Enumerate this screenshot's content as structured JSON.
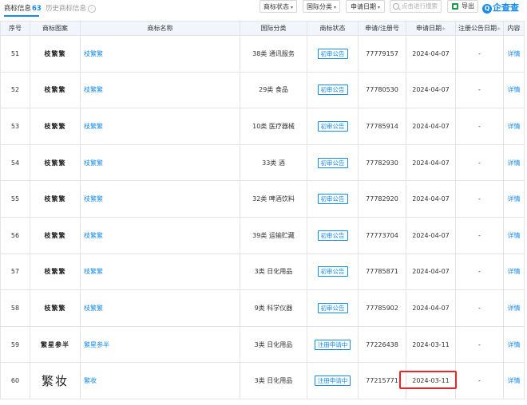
{
  "tabs": {
    "active_label": "商标信息",
    "active_count": "63",
    "history_label": "历史商标信息",
    "info_icon": "i"
  },
  "filters": {
    "status_label": "商标状态",
    "category_label": "国际分类",
    "date_label": "申请日期",
    "caret": "▾"
  },
  "search": {
    "placeholder": "点击进行搜索"
  },
  "export": {
    "label": "导出"
  },
  "brand": {
    "logo_glyph": "Q",
    "name": "企查查"
  },
  "columns": [
    "序号",
    "商标图案",
    "商标名称",
    "国际分类",
    "商标状态",
    "申请/注册号",
    "申请日期",
    "注册公告日期",
    "内容"
  ],
  "sort_glyph": "≑",
  "rows": [
    {
      "no": "51",
      "image_text": "枝繁繁",
      "name": "枝繁繁",
      "category": "38类 通讯服务",
      "status": "初审公告",
      "reg_no": "77779157",
      "apply_date": "2024-04-07",
      "notice_date": "-",
      "detail": "详情"
    },
    {
      "no": "52",
      "image_text": "枝繁繁",
      "name": "枝繁繁",
      "category": "29类 食品",
      "status": "初审公告",
      "reg_no": "77780530",
      "apply_date": "2024-04-07",
      "notice_date": "-",
      "detail": "详情"
    },
    {
      "no": "53",
      "image_text": "枝繁繁",
      "name": "枝繁繁",
      "category": "10类 医疗器械",
      "status": "初审公告",
      "reg_no": "77785914",
      "apply_date": "2024-04-07",
      "notice_date": "-",
      "detail": "详情"
    },
    {
      "no": "54",
      "image_text": "枝繁繁",
      "name": "枝繁繁",
      "category": "33类 酒",
      "status": "初审公告",
      "reg_no": "77782930",
      "apply_date": "2024-04-07",
      "notice_date": "-",
      "detail": "详情"
    },
    {
      "no": "55",
      "image_text": "枝繁繁",
      "name": "枝繁繁",
      "category": "32类 啤酒饮料",
      "status": "初审公告",
      "reg_no": "77782920",
      "apply_date": "2024-04-07",
      "notice_date": "-",
      "detail": "详情"
    },
    {
      "no": "56",
      "image_text": "枝繁繁",
      "name": "枝繁繁",
      "category": "39类 运输贮藏",
      "status": "初审公告",
      "reg_no": "77773704",
      "apply_date": "2024-04-07",
      "notice_date": "-",
      "detail": "详情"
    },
    {
      "no": "57",
      "image_text": "枝繁繁",
      "name": "枝繁繁",
      "category": "3类 日化用品",
      "status": "初审公告",
      "reg_no": "77785871",
      "apply_date": "2024-04-07",
      "notice_date": "-",
      "detail": "详情"
    },
    {
      "no": "58",
      "image_text": "枝繁繁",
      "name": "枝繁繁",
      "category": "9类 科学仪器",
      "status": "初审公告",
      "reg_no": "77785902",
      "apply_date": "2024-04-07",
      "notice_date": "-",
      "detail": "详情"
    },
    {
      "no": "59",
      "image_text": "繁星参半",
      "name": "繁星参半",
      "category": "3类 日化用品",
      "status": "注册申请中",
      "reg_no": "77226438",
      "apply_date": "2024-03-11",
      "notice_date": "-",
      "detail": "详情"
    },
    {
      "no": "60",
      "image_text": "繁妆",
      "name": "繁妆",
      "category": "3类 日化用品",
      "status": "注册申请中",
      "reg_no": "77215771",
      "apply_date": "2024-03-11",
      "notice_date": "-",
      "detail": "详情"
    }
  ],
  "colors": {
    "accent": "#128bed",
    "header_bg": "#f2f6fc",
    "highlight": "#e5262b",
    "export_icon": "#1a9b4b"
  }
}
